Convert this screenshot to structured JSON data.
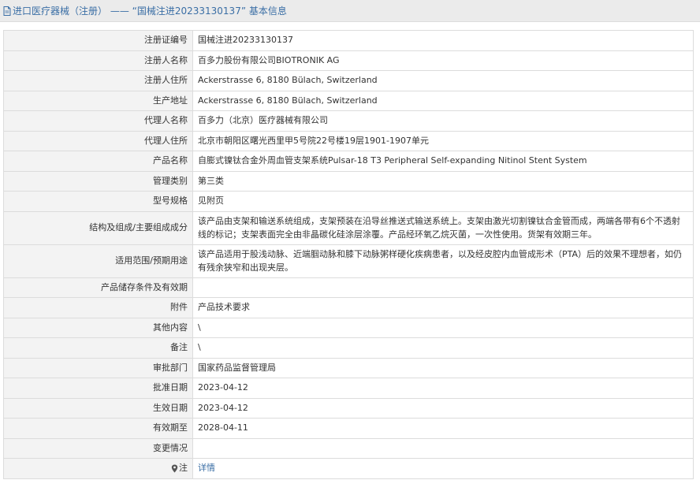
{
  "header": {
    "title": "进口医疗器械（注册） —— “国械注进20233130137” 基本信息"
  },
  "rows": [
    {
      "label": "注册证编号",
      "value": "国械注进20233130137"
    },
    {
      "label": "注册人名称",
      "value": "百多力股份有限公司BIOTRONIK AG"
    },
    {
      "label": "注册人住所",
      "value": "Ackerstrasse 6, 8180 Bülach, Switzerland"
    },
    {
      "label": "生产地址",
      "value": "Ackerstrasse 6, 8180 Bülach, Switzerland"
    },
    {
      "label": "代理人名称",
      "value": "百多力（北京）医疗器械有限公司"
    },
    {
      "label": "代理人住所",
      "value": "北京市朝阳区曙光西里甲5号院22号楼19层1901-1907单元"
    },
    {
      "label": "产品名称",
      "value": "自膨式镍钛合金外周血管支架系统Pulsar-18 T3 Peripheral Self-expanding Nitinol Stent System"
    },
    {
      "label": "管理类别",
      "value": "第三类"
    },
    {
      "label": "型号规格",
      "value": "见附页"
    },
    {
      "label": "结构及组成/主要组成成分",
      "value": "该产品由支架和输送系统组成，支架预装在沿导丝推送式输送系统上。支架由激光切割镍钛合金管而成，两端各带有6个不透射线的标记；支架表面完全由非晶碳化硅涂层涂覆。产品经环氧乙烷灭菌，一次性使用。货架有效期三年。"
    },
    {
      "label": "适用范围/预期用途",
      "value": "该产品适用于股浅动脉、近端腘动脉和膝下动脉粥样硬化疾病患者，以及经皮腔内血管成形术（PTA）后的效果不理想者，如仍有残余狭窄和出现夹层。"
    },
    {
      "label": "产品储存条件及有效期",
      "value": ""
    },
    {
      "label": "附件",
      "value": "产品技术要求"
    },
    {
      "label": "其他内容",
      "value": "\\"
    },
    {
      "label": "备注",
      "value": "\\"
    },
    {
      "label": "审批部门",
      "value": "国家药品监督管理局"
    },
    {
      "label": "批准日期",
      "value": "2023-04-12"
    },
    {
      "label": "生效日期",
      "value": "2023-04-12"
    },
    {
      "label": "有效期至",
      "value": "2028-04-11"
    },
    {
      "label": "变更情况",
      "value": ""
    },
    {
      "label": "注",
      "value": "详情"
    }
  ],
  "icons": {
    "title": "document-icon",
    "note": "pin-icon"
  },
  "colors": {
    "link": "#3a6ea5",
    "label_bg": "#f3f3f3",
    "header_bg": "#ebebeb",
    "border": "#dcdcdc"
  }
}
